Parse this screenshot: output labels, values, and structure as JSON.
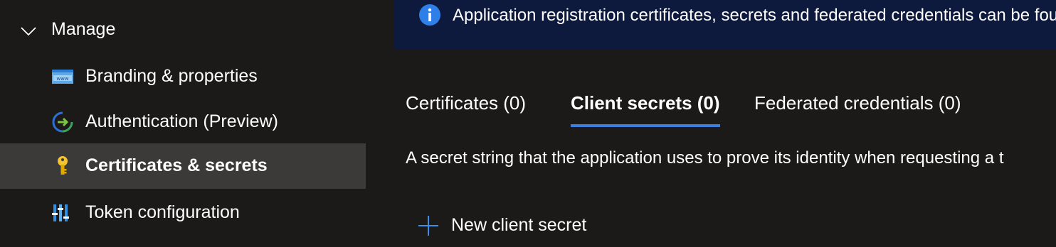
{
  "sidebar": {
    "section_label": "Manage",
    "items": [
      {
        "label": "Branding & properties",
        "icon": "branding-www-icon"
      },
      {
        "label": "Authentication (Preview)",
        "icon": "authentication-arrow-icon"
      },
      {
        "label": "Certificates & secrets",
        "icon": "key-icon",
        "selected": true
      },
      {
        "label": "Token configuration",
        "icon": "token-bars-icon"
      }
    ]
  },
  "banner": {
    "icon": "info-icon",
    "text": "Application registration certificates, secrets and federated credentials can be fou"
  },
  "tabs": [
    {
      "label": "Certificates (0)"
    },
    {
      "label": "Client secrets (0)",
      "active": true
    },
    {
      "label": "Federated credentials (0)"
    }
  ],
  "description": "A secret string that the application uses to prove its identity when requesting a t",
  "actions": {
    "new_client_secret": "New client secret"
  },
  "colors": {
    "accent": "#3a7fe0",
    "banner_bg": "#0e1a3d",
    "selected_bg": "#3b3a39",
    "page_bg": "#1b1a19"
  }
}
